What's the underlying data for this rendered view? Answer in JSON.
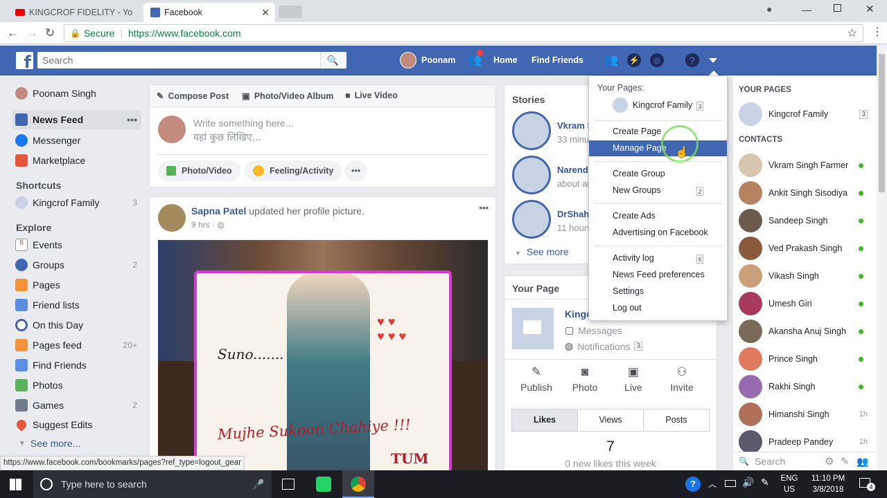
{
  "browser": {
    "tabs": [
      {
        "title": "KINGCROF FIDELITY - Yo",
        "active": false
      },
      {
        "title": "Facebook",
        "active": true
      }
    ],
    "secure_label": "Secure",
    "url": "https://www.facebook.com"
  },
  "fb_header": {
    "search_placeholder": "Search",
    "user_name": "Poonam",
    "home_label": "Home",
    "find_friends_label": "Find Friends"
  },
  "left_nav": {
    "profile_name": "Poonam Singh",
    "news_feed": "News Feed",
    "messenger": "Messenger",
    "marketplace": "Marketplace",
    "shortcuts_heading": "Shortcuts",
    "shortcut_item": {
      "label": "Kingcrof Family",
      "count": "3"
    },
    "explore_heading": "Explore",
    "explore_items": [
      {
        "label": "Events",
        "count": ""
      },
      {
        "label": "Groups",
        "count": "2"
      },
      {
        "label": "Pages",
        "count": ""
      },
      {
        "label": "Friend lists",
        "count": ""
      },
      {
        "label": "On this Day",
        "count": ""
      },
      {
        "label": "Pages feed",
        "count": "20+"
      },
      {
        "label": "Find Friends",
        "count": ""
      },
      {
        "label": "Photos",
        "count": ""
      },
      {
        "label": "Games",
        "count": "2"
      },
      {
        "label": "Suggest Edits",
        "count": ""
      }
    ],
    "see_more": "See more..."
  },
  "composer": {
    "tab_compose": "Compose Post",
    "tab_album": "Photo/Video Album",
    "tab_live": "Live Video",
    "placeholder_line1": "Write something here...",
    "placeholder_line2": "यहां कुछ लिखिए...",
    "photo_video": "Photo/Video",
    "feeling_activity": "Feeling/Activity",
    "more": "•••"
  },
  "post": {
    "author": "Sapna Patel",
    "action": "updated her profile picture.",
    "time": "9 hrs",
    "image_text_1": "Suno.......",
    "image_text_2": "Mujhe Sukoon Chahiye !!!",
    "image_text_3": "TUM"
  },
  "stories": {
    "heading": "Stories",
    "items": [
      {
        "name": "Vkram S",
        "sub": "33 minu"
      },
      {
        "name": "Narendr",
        "sub": "about an"
      },
      {
        "name": "DrShahi",
        "sub": "11 hours"
      }
    ],
    "see_more": "See more"
  },
  "your_page": {
    "heading": "Your Page",
    "page_name": "Kingc",
    "messages": "Messages",
    "notifications": "Notifications",
    "notifications_count": "3",
    "actions": [
      "Publish",
      "Photo",
      "Live",
      "Invite"
    ],
    "tabs": [
      "Likes",
      "Views",
      "Posts"
    ],
    "likes_count": "7",
    "likes_note": "0 new likes this week"
  },
  "dropdown": {
    "your_pages_label": "Your Pages:",
    "page_name": "Kingcrof Family",
    "page_count": "3",
    "create_page": "Create Page",
    "manage_page": "Manage Page",
    "create_group": "Create Group",
    "new_groups": "New Groups",
    "new_groups_count": "2",
    "create_ads": "Create Ads",
    "advertising": "Advertising on Facebook",
    "activity_log": "Activity log",
    "activity_log_count": "6",
    "news_feed_prefs": "News Feed preferences",
    "settings": "Settings",
    "log_out": "Log out"
  },
  "right_col": {
    "your_pages_heading": "YOUR PAGES",
    "page_name": "Kingcrof Family",
    "page_count": "3",
    "contacts_heading": "CONTACTS",
    "contacts": [
      {
        "name": "Vkram Singh Farmer",
        "status": ""
      },
      {
        "name": "Ankit Singh Sisodiya",
        "status": ""
      },
      {
        "name": "Sandeep Singh",
        "status": ""
      },
      {
        "name": "Ved Prakash Singh",
        "status": ""
      },
      {
        "name": "Vikash Singh",
        "status": ""
      },
      {
        "name": "Umesh Giri",
        "status": ""
      },
      {
        "name": "Akansha Anuj Singh",
        "status": ""
      },
      {
        "name": "Prince Singh",
        "status": ""
      },
      {
        "name": "Rakhi Singh",
        "status": ""
      },
      {
        "name": "Himanshi Singh",
        "status": "1h"
      },
      {
        "name": "Pradeep Pandey",
        "status": "1h"
      }
    ],
    "search_placeholder": "Search"
  },
  "status_url": "https://www.facebook.com/bookmarks/pages?ref_type=logout_gear",
  "taskbar": {
    "search_placeholder": "Type here to search",
    "lang_line1": "ENG",
    "lang_line2": "US",
    "time": "11:10 PM",
    "date": "3/8/2018",
    "notif_count": "4"
  },
  "colors": {
    "fb_blue": "#4267b2",
    "link_blue": "#365899",
    "online_green": "#42b72a"
  }
}
